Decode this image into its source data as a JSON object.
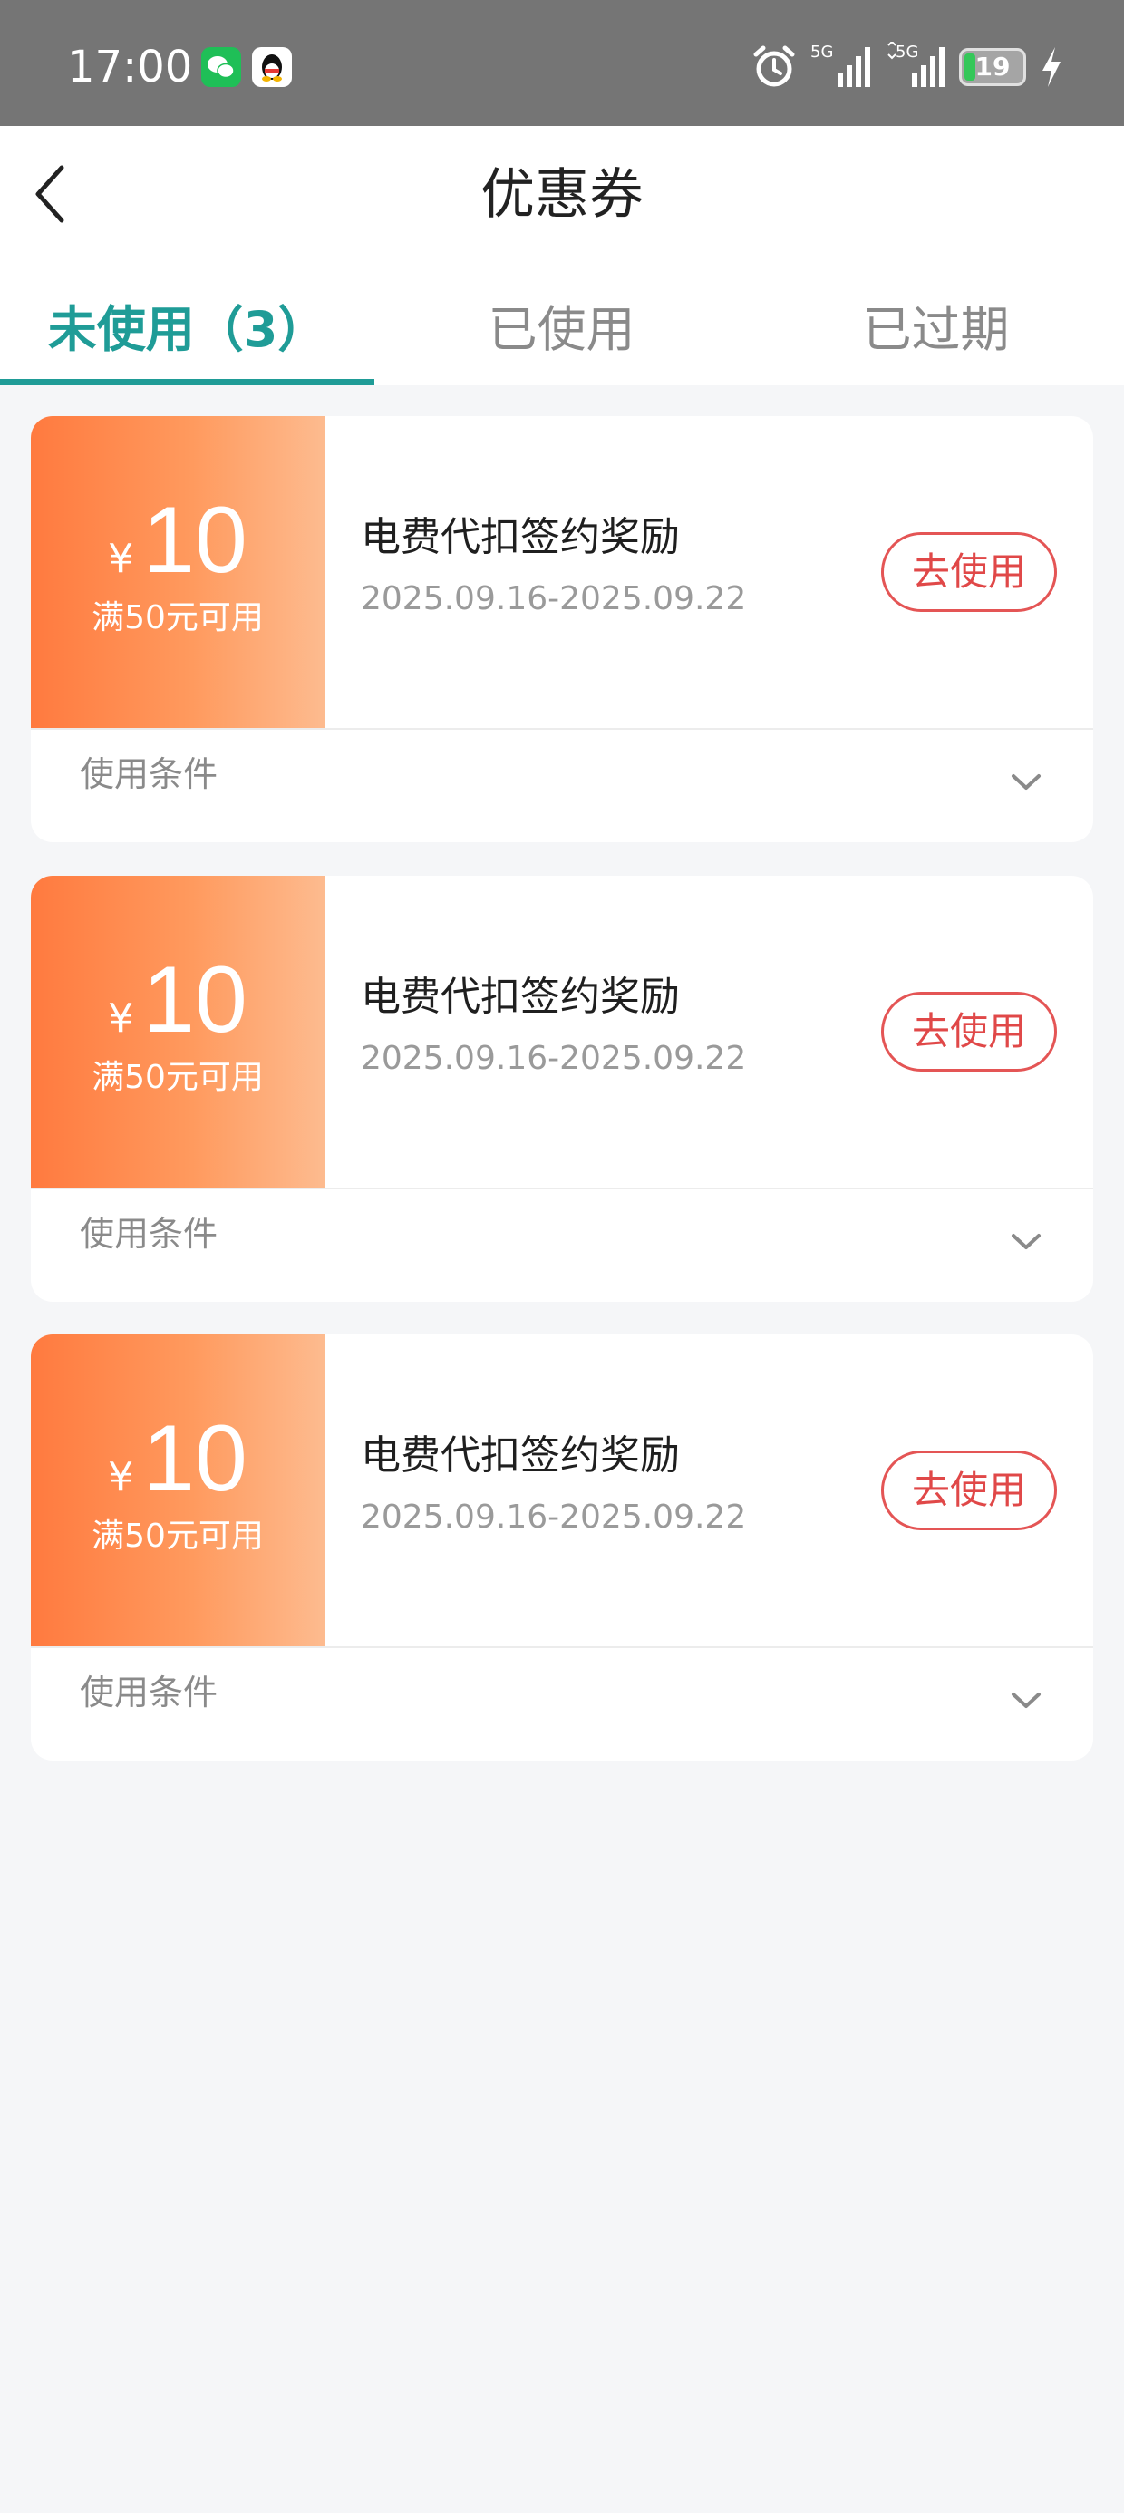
{
  "status_bar": {
    "time": "17:00",
    "signal_1": "5G",
    "signal_2": "5G",
    "battery": "19"
  },
  "header": {
    "title": "优惠券"
  },
  "tabs": [
    {
      "label": "未使用（3）",
      "active": true
    },
    {
      "label": "已使用",
      "active": false
    },
    {
      "label": "已过期",
      "active": false
    }
  ],
  "coupons": [
    {
      "currency": "¥",
      "amount": "10",
      "condition": "满50元可用",
      "name": "电费代扣签约奖励",
      "date_range": "2025.09.16-2025.09.22",
      "action_label": "去使用",
      "terms_label": "使用条件"
    },
    {
      "currency": "¥",
      "amount": "10",
      "condition": "满50元可用",
      "name": "电费代扣签约奖励",
      "date_range": "2025.09.16-2025.09.22",
      "action_label": "去使用",
      "terms_label": "使用条件"
    },
    {
      "currency": "¥",
      "amount": "10",
      "condition": "满50元可用",
      "name": "电费代扣签约奖励",
      "date_range": "2025.09.16-2025.09.22",
      "action_label": "去使用",
      "terms_label": "使用条件"
    }
  ],
  "colors": {
    "accent": "#1f9c97",
    "coupon_gradient_start": "#ff7a3f",
    "coupon_gradient_end": "#fdbb8f",
    "action_red": "#e04848",
    "status_bar": "#757575",
    "page_background": "#f5f6f8"
  }
}
